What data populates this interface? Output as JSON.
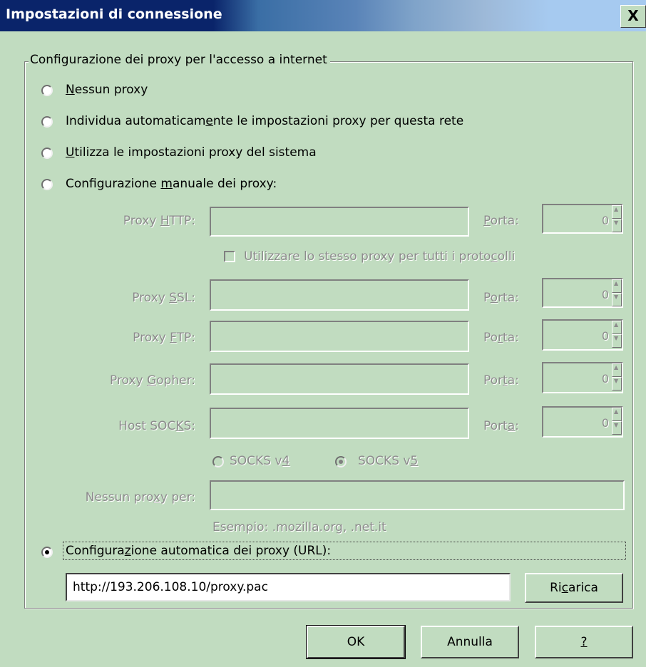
{
  "window": {
    "title": "Impostazioni di connessione",
    "close_glyph": "X"
  },
  "group": {
    "legend": "Configurazione dei proxy per l'accesso a internet"
  },
  "radios": {
    "none": {
      "pre": "",
      "u": "N",
      "post": "essun proxy",
      "selected": false
    },
    "auto_detect": {
      "pre": "Individua automaticam",
      "u": "e",
      "post": "nte le impostazioni proxy per questa rete",
      "selected": false
    },
    "system": {
      "pre": "",
      "u": "U",
      "post": "tilizza le impostazioni proxy del sistema",
      "selected": false
    },
    "manual": {
      "pre": "Configurazione ",
      "u": "m",
      "post": "anuale dei proxy:",
      "selected": false
    },
    "pac": {
      "pre": "Configura",
      "u": "z",
      "post": "ione automatica dei proxy (URL):",
      "selected": true
    }
  },
  "manual": {
    "http": {
      "pre": "Proxy ",
      "u": "H",
      "post": "TTP:",
      "value": "",
      "port_pre": "",
      "port_u": "P",
      "port_post": "orta:",
      "port": "0"
    },
    "same_proxy": {
      "pre": "Utilizzare lo stesso proxy per tutti i proto",
      "u": "c",
      "post": "olli",
      "checked": false
    },
    "ssl": {
      "pre": "Proxy ",
      "u": "S",
      "post": "SL:",
      "value": "",
      "port_pre": "P",
      "port_u": "o",
      "port_post": "rta:",
      "port": "0"
    },
    "ftp": {
      "pre": "Proxy ",
      "u": "F",
      "post": "TP:",
      "value": "",
      "port_pre": "Po",
      "port_u": "r",
      "port_post": "ta:",
      "port": "0"
    },
    "gopher": {
      "pre": "Proxy ",
      "u": "G",
      "post": "opher:",
      "value": "",
      "port_pre": "Por",
      "port_u": "t",
      "port_post": "a:",
      "port": "0"
    },
    "socks": {
      "pre": "Host SOC",
      "u": "K",
      "post": "S:",
      "value": "",
      "port_pre": "Port",
      "port_u": "a",
      "port_post": ":",
      "port": "0"
    },
    "socks_v4": {
      "pre": "SOCKS v",
      "u": "4",
      "post": "",
      "selected": false
    },
    "socks_v5": {
      "pre": "SOCKS v",
      "u": "5",
      "post": "",
      "selected": true
    },
    "no_proxy": {
      "pre": "Nessun pro",
      "u": "x",
      "post": "y per:",
      "value": ""
    },
    "example": "Esempio: .mozilla.org, .net.it"
  },
  "pac": {
    "url": "http://193.206.108.10/proxy.pac",
    "reload_pre": "Ri",
    "reload_u": "c",
    "reload_post": "arica"
  },
  "buttons": {
    "ok": "OK",
    "cancel": "Annulla",
    "help": "?"
  },
  "colors": {
    "face": "#c1dcc0",
    "title_active": "#0a246a",
    "disabled_text": "#8c8c8c"
  }
}
